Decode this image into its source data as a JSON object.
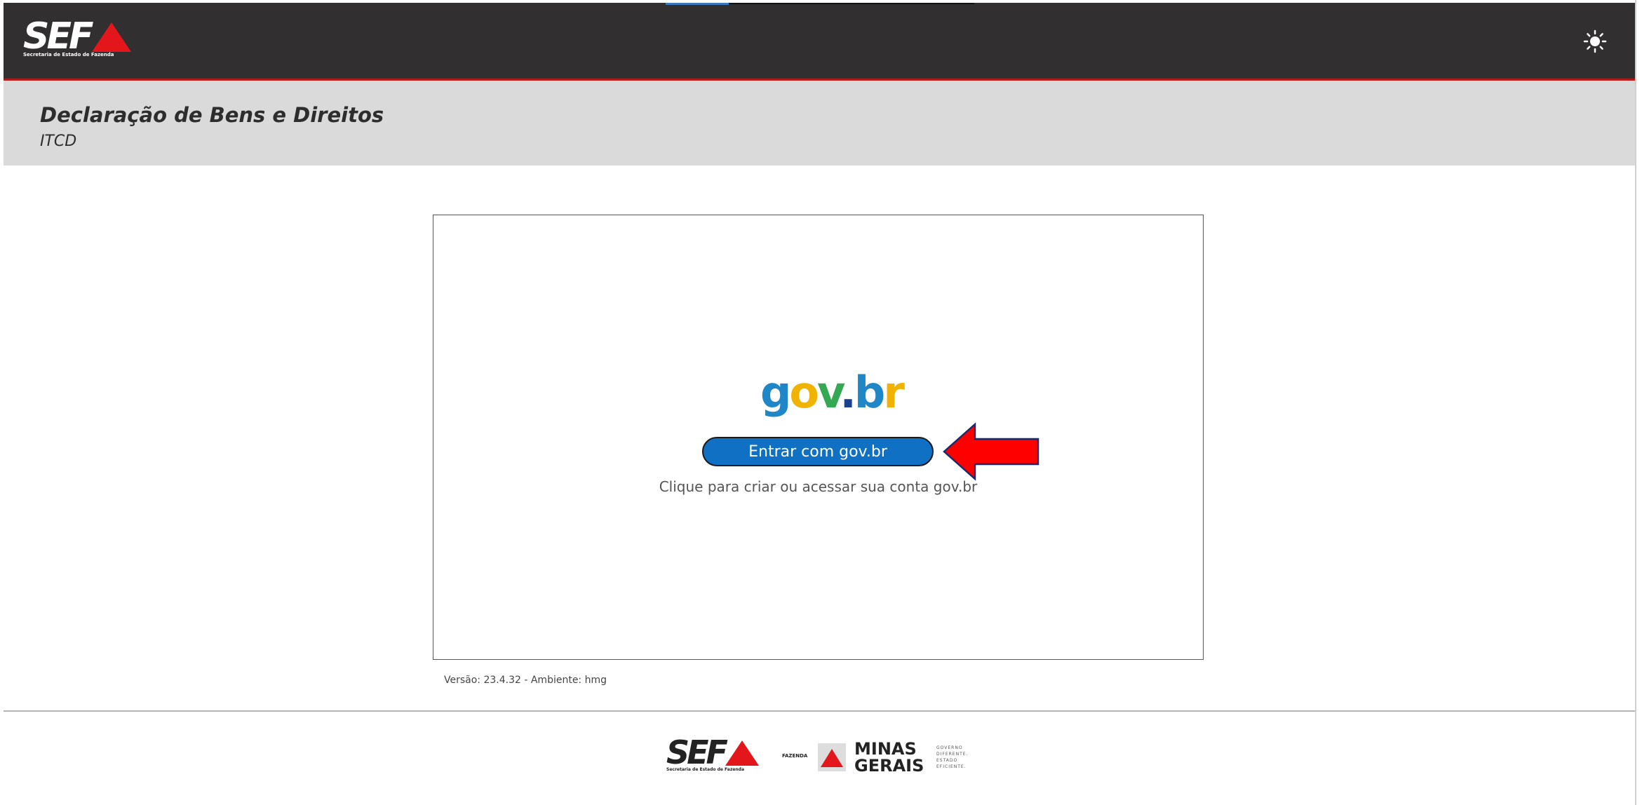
{
  "header": {
    "logo_text": "SEF",
    "logo_subtitle": "Secretaria de Estado de Fazenda",
    "theme_icon": "sun-icon"
  },
  "page": {
    "title": "Declaração de Bens e Direitos",
    "subtitle": "ITCD"
  },
  "login_card": {
    "govbr_logo": "gov.br",
    "button_label": "Entrar com gov.br",
    "helper_text": "Clique para criar ou acessar sua conta gov.br"
  },
  "version_text": "Versão: 23.4.32 - Ambiente: hmg",
  "footer": {
    "sef_text": "SEF",
    "sef_subtitle": "Secretaria de Estado de Fazenda",
    "fazenda_label": "FAZENDA",
    "minas_gerais": "MINAS GERAIS",
    "tagline": "GOVERNO DIFERENTE. ESTADO EFICIENTE."
  },
  "colors": {
    "topbar": "#322f30",
    "accent_red": "#e3171b",
    "button_blue": "#1071c4",
    "header_band": "#dadada"
  }
}
